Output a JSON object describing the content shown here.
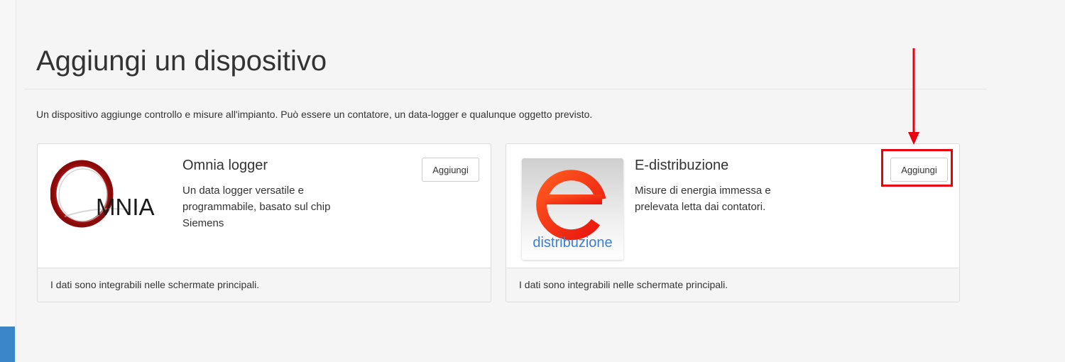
{
  "page": {
    "title": "Aggiungi un dispositivo",
    "intro": "Un dispositivo aggiunge controllo e misure all'impianto. Può essere un contatore, un data-logger e qualunque oggetto previsto."
  },
  "devices": [
    {
      "name": "Omnia logger",
      "description": "Un data logger versatile e programmabile, basato sul chip Siemens",
      "button_label": "Aggiungi",
      "footer": "I dati sono integrabili nelle schermate principali.",
      "logo": {
        "icon": "omnia-logo",
        "text_first": "O",
        "text_rest": "MNIA",
        "color": "#c4161c"
      }
    },
    {
      "name": "E-distribuzione",
      "description": "Misure di energia immessa e prelevata letta dai contatori.",
      "button_label": "Aggiungi",
      "footer": "I dati sono integrabili nelle schermate principali.",
      "logo": {
        "icon": "e-distribuzione-logo",
        "text": "distribuzione",
        "letter_color": "#e8300e",
        "text_color": "#3b7fd8"
      }
    }
  ],
  "annotation": {
    "color": "#e8000d"
  },
  "sidebar": {
    "accent_color": "#3a86c8"
  }
}
